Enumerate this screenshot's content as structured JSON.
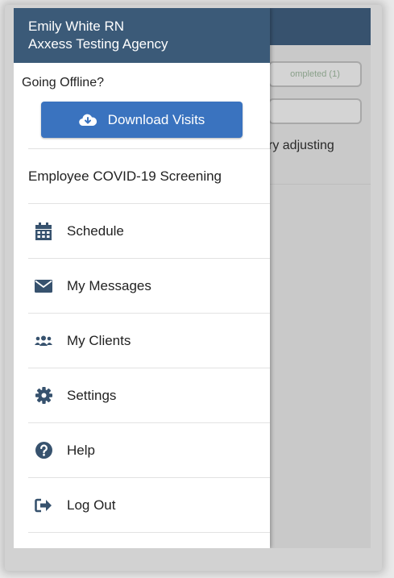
{
  "drawer": {
    "user_name": "Emily White RN",
    "agency": "Axxess Testing Agency",
    "offline_label": "Going Offline?",
    "download_button": "Download Visits",
    "items": [
      {
        "label": "Employee COVID-19 Screening",
        "icon": "none"
      },
      {
        "label": "Schedule",
        "icon": "calendar-icon"
      },
      {
        "label": "My Messages",
        "icon": "envelope-icon"
      },
      {
        "label": "My Clients",
        "icon": "users-icon"
      },
      {
        "label": "Settings",
        "icon": "gear-icon"
      },
      {
        "label": "Help",
        "icon": "question-circle-icon"
      },
      {
        "label": "Log Out",
        "icon": "sign-out-icon"
      }
    ]
  },
  "background": {
    "completed_tab": "ompleted (1)",
    "partial_text": "ry adjusting"
  },
  "colors": {
    "header": "#3b5a78",
    "button": "#3a73bf",
    "icon": "#37526e"
  }
}
